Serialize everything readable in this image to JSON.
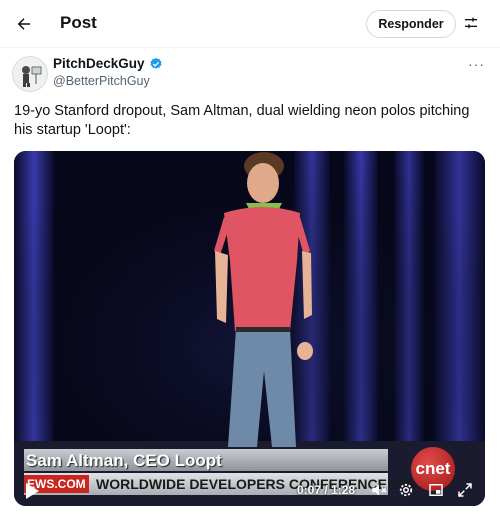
{
  "header": {
    "title": "Post",
    "reply_label": "Responder",
    "back_icon": "arrow-left-icon",
    "settings_icon": "sliders-icon"
  },
  "tweet": {
    "author_name": "PitchDeckGuy",
    "handle": "@BetterPitchGuy",
    "verified": true,
    "text": "19-yo Stanford dropout, Sam Altman, dual wielding neon polos pitching his startup 'Loopt':",
    "more_icon": "···"
  },
  "video": {
    "lower_third": "Sam Altman, CEO Loopt",
    "news_tag": "EWS.COM",
    "ticker": "WORLDWIDE DEVELOPERS CONFERENCE 2008",
    "logo": "cnet",
    "time": "0:07 / 1:28",
    "progress": 0.08
  },
  "colors": {
    "accent": "#1d9bf0",
    "text": "#0f1419",
    "muted": "#536471"
  }
}
